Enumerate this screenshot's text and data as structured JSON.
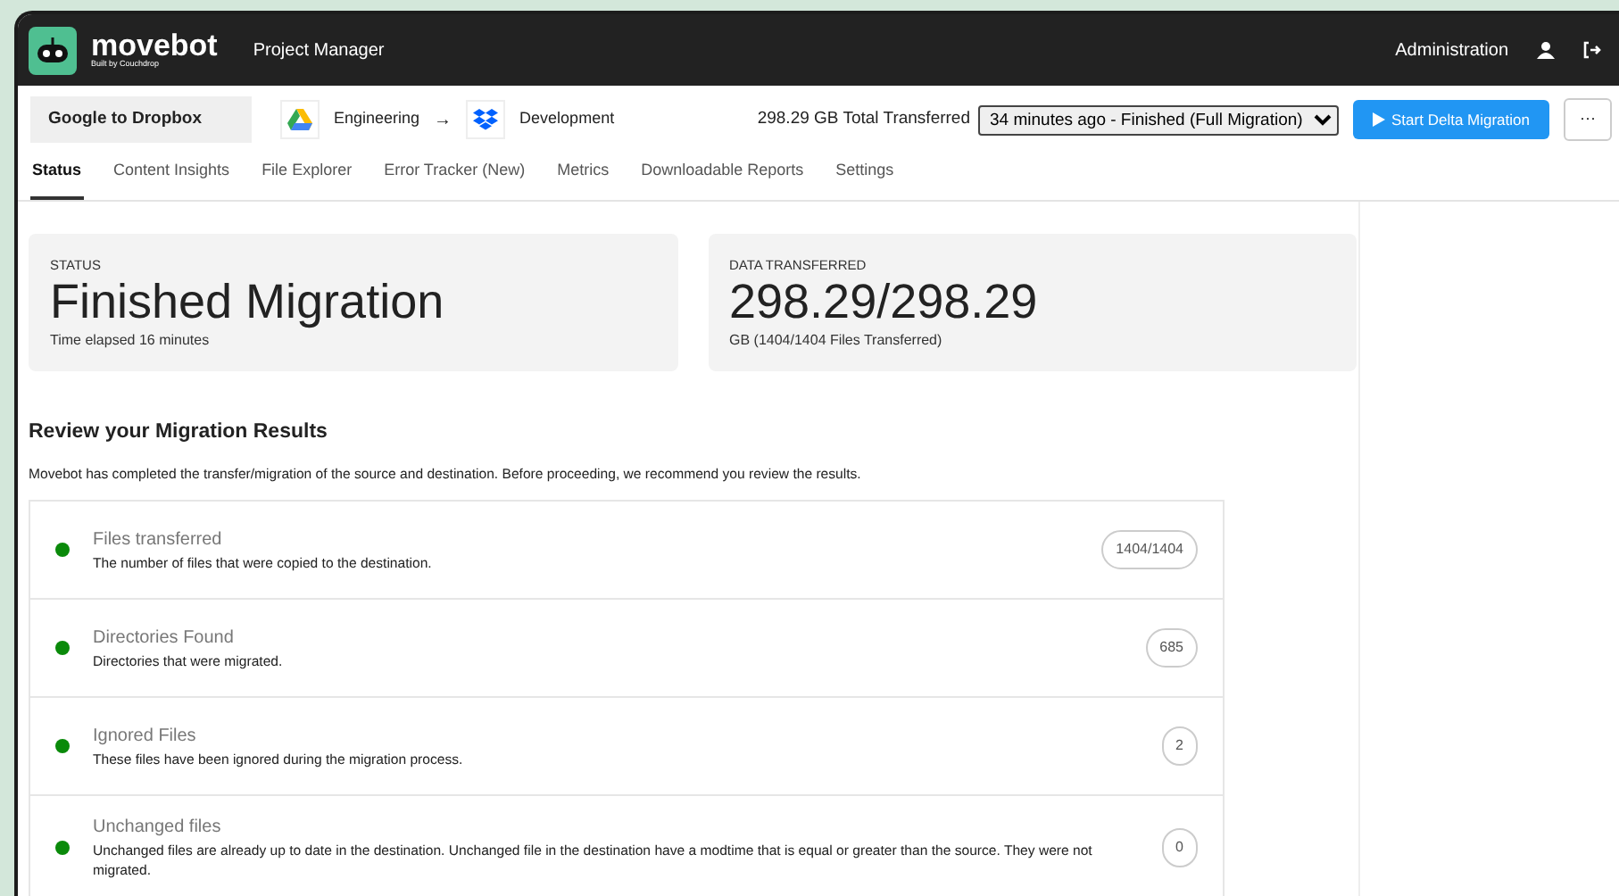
{
  "app": {
    "logo_text": "movebot",
    "logo_subtext": "Built by Couchdrop",
    "section": "Project Manager",
    "admin_link": "Administration"
  },
  "project": {
    "name": "Google to Dropbox",
    "source": "Engineering",
    "arrow": "→",
    "destination": "Development",
    "total": "298.29 GB Total Transferred",
    "run_select": "34 minutes ago - Finished (Full Migration)",
    "start_button": "Start Delta Migration",
    "more_button": "···"
  },
  "tabs": [
    {
      "label": "Status",
      "selected": true
    },
    {
      "label": "Content Insights",
      "selected": false
    },
    {
      "label": "File Explorer",
      "selected": false
    },
    {
      "label": "Error Tracker (New)",
      "selected": false
    },
    {
      "label": "Metrics",
      "selected": false
    },
    {
      "label": "Downloadable Reports",
      "selected": false
    },
    {
      "label": "Settings",
      "selected": false
    }
  ],
  "stats": [
    {
      "label": "STATUS",
      "value": "Finished Migration",
      "note": "Time elapsed 16 minutes"
    },
    {
      "label": "DATA TRANSFERRED",
      "value": "298.29/298.29",
      "note": "GB (1404/1404 Files Transferred)"
    }
  ],
  "review": {
    "title": "Review your Migration Results",
    "description": "Movebot has completed the transfer/migration of the source and destination. Before proceeding, we recommend you review the results.",
    "results": [
      {
        "title": "Files transferred",
        "description": "The number of files that were copied to the destination.",
        "count": "1404/1404",
        "color": "#0a8a0a"
      },
      {
        "title": "Directories Found",
        "description": "Directories that were migrated.",
        "count": "685",
        "color": "#0a8a0a"
      },
      {
        "title": "Ignored Files",
        "description": "These files have been ignored during the migration process.",
        "count": "2",
        "color": "#0a8a0a"
      },
      {
        "title": "Unchanged files",
        "description": "Unchanged files are already up to date in the destination. Unchanged file in the destination have a modtime that is equal or greater than the source. They were not migrated.",
        "count": "0",
        "color": "#0a8a0a"
      }
    ]
  }
}
